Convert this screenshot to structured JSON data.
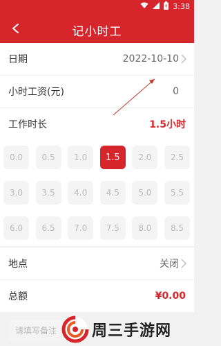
{
  "status_bar": {
    "time": "3:38",
    "icons": [
      "wifi-icon",
      "signal-icon",
      "battery-icon"
    ]
  },
  "app_bar": {
    "title": "记小时工",
    "back_icon": "chevron-left-icon"
  },
  "form": {
    "date": {
      "label": "日期",
      "value": "2022-10-10"
    },
    "hourly_wage": {
      "label": "小时工资(元)",
      "value": "0"
    },
    "work_hours": {
      "label": "工作时长",
      "value": "1.5小时"
    },
    "hour_options": [
      "0.0",
      "0.5",
      "1.0",
      "1.5",
      "2.0",
      "2.5",
      "3.0",
      "3.5",
      "4.0",
      "4.5",
      "5.0",
      "5.5",
      "6.0",
      "6.5",
      "7.0",
      "7.5",
      "8.0",
      "8.5"
    ],
    "selected_hours": "1.5",
    "location": {
      "label": "地点",
      "value": "关闭"
    },
    "total": {
      "label": "总额",
      "value": "¥0.00"
    },
    "remark_placeholder": "请填写备注"
  },
  "watermark": {
    "text": "周三手游网"
  },
  "colors": {
    "brand": "#d7252c",
    "chip_bg": "#f4f4f4",
    "chip_text": "#bbbbbb"
  }
}
